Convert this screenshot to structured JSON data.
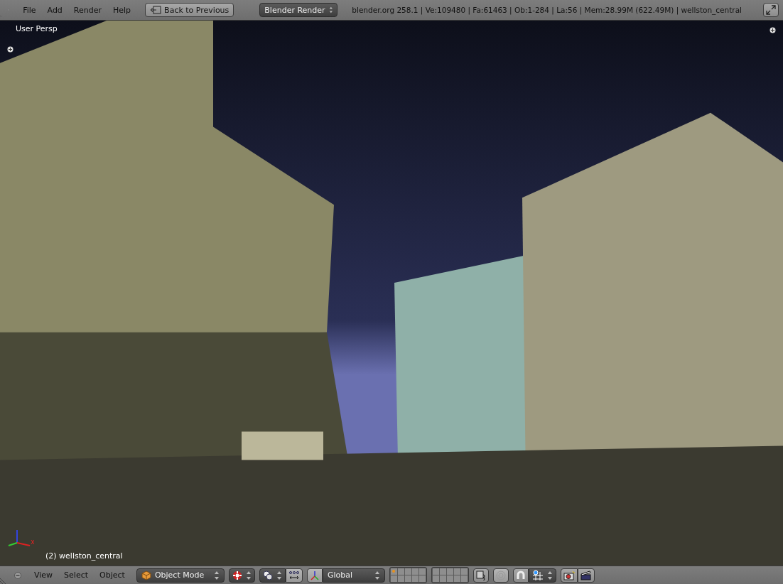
{
  "info_header": {
    "menus": [
      "File",
      "Add",
      "Render",
      "Help"
    ],
    "back_button": "Back to Previous",
    "render_engine": "Blender Render",
    "stats": "blender.org 258.1 | Ve:109480 | Fa:61463 | Ob:1-284 | La:56 | Mem:28.99M (622.49M) | wellston_central"
  },
  "viewport": {
    "view_name": "User Persp",
    "object_label": "(2) wellston_central"
  },
  "view_header": {
    "menus": [
      "View",
      "Select",
      "Object"
    ],
    "mode": "Object Mode",
    "orientation": "Global",
    "layers": [
      {
        "has_objects": true
      },
      {
        "has_objects": false
      },
      {
        "has_objects": false
      },
      {
        "has_objects": false
      },
      {
        "has_objects": false
      },
      {
        "has_objects": false
      },
      {
        "has_objects": false
      },
      {
        "has_objects": false
      },
      {
        "has_objects": false
      },
      {
        "has_objects": false
      },
      {
        "has_objects": false
      },
      {
        "has_objects": false
      },
      {
        "has_objects": false
      },
      {
        "has_objects": false
      },
      {
        "has_objects": false
      },
      {
        "has_objects": false
      },
      {
        "has_objects": false
      },
      {
        "has_objects": false
      },
      {
        "has_objects": false
      },
      {
        "has_objects": false
      }
    ],
    "snap_on": false
  }
}
